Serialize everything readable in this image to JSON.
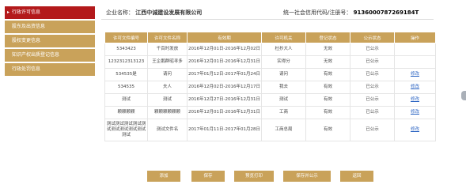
{
  "sidebar": {
    "items": [
      {
        "label": "行政许可信息",
        "active": true
      },
      {
        "label": "股东及出资信息",
        "active": false
      },
      {
        "label": "股权变更信息",
        "active": false
      },
      {
        "label": "知识产权出质登记信息",
        "active": false
      },
      {
        "label": "行政处罚信息",
        "active": false
      }
    ]
  },
  "info": {
    "company_label": "企业名称：",
    "company_name": "江西中诚建设发展有限公司",
    "code_label": "统一社会信用代码/注册号：",
    "code_value": "9136000787269184T"
  },
  "table": {
    "headers": [
      "许可文件编号",
      "许可文件名称",
      "有效期",
      "许可机关",
      "登记状态",
      "公示状态",
      "操作"
    ],
    "rows": [
      {
        "no": "5343423",
        "name": "千百时发放",
        "period": "2016年12月01日-2016年12月02日",
        "org": "杜抄大人",
        "status": "无效",
        "pub": "已公示",
        "op": ""
      },
      {
        "no": "1232312313123",
        "name": "王企鹅群昭寻多",
        "period": "2016年12月01日-2016年12月31日",
        "org": "实得分",
        "status": "无效",
        "pub": "已公示",
        "op": ""
      },
      {
        "no": "534535是",
        "name": "请问",
        "period": "2017年01月12日-2017年01月24日",
        "org": "请问",
        "status": "有效",
        "pub": "已公示",
        "op": "修改"
      },
      {
        "no": "534535",
        "name": "夫人",
        "period": "2016年12月02日-2016年12月17日",
        "org": "我去",
        "status": "有效",
        "pub": "已公示",
        "op": "修改"
      },
      {
        "no": "测试",
        "name": "测试",
        "period": "2016年12月27日-2016年12月31日",
        "org": "测试",
        "status": "有效",
        "pub": "已公示",
        "op": "修改"
      },
      {
        "no": "颗颗颗颗",
        "name": "颗颗颗颗颗颗",
        "period": "2016年12月01日-2016年12月31日",
        "org": "工商",
        "status": "有效",
        "pub": "已公示",
        "op": "修改"
      },
      {
        "no": "测试测试测试测试测试测试测试测试测试测试",
        "name": "测试文件名",
        "period": "2017年01月11日-2017年01月28日",
        "org": "工商总局",
        "status": "有效",
        "pub": "已公示",
        "op": "修改"
      }
    ]
  },
  "buttons": {
    "add": "添加",
    "save": "保存",
    "preview": "预览打印",
    "save_publish": "保存并公示",
    "back": "返回"
  }
}
